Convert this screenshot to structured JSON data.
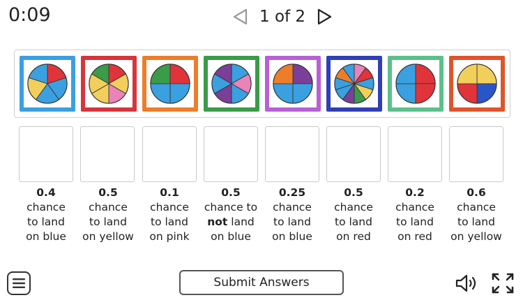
{
  "timer": "0:09",
  "pagination": {
    "label": "1 of 2",
    "prev_icon": "triangle-left-icon",
    "next_icon": "triangle-right-icon"
  },
  "cards": [
    {
      "name": "spinner-card-1",
      "frame_color": "#3aa0e0",
      "slices": [
        "#e0343a",
        "#3aa0e0",
        "#3aa0e0",
        "#f2cf5b",
        "#3aa0e0"
      ]
    },
    {
      "name": "spinner-card-2",
      "frame_color": "#d8343c",
      "slices": [
        "#e0343a",
        "#f2cf5b",
        "#e983b8",
        "#f2cf5b",
        "#f2cf5b",
        "#3a9c48"
      ]
    },
    {
      "name": "spinner-card-3",
      "frame_color": "#ee7d2a",
      "slices": [
        "#e0343a",
        "#3aa0e0",
        "#3aa0e0",
        "#3a9c48"
      ]
    },
    {
      "name": "spinner-card-4",
      "frame_color": "#3a9c48",
      "slices": [
        "#3aa0e0",
        "#e983b8",
        "#3aa0e0",
        "#7a3f98",
        "#3aa0e0",
        "#7a3f98"
      ]
    },
    {
      "name": "spinner-card-5",
      "frame_color": "#b85fd6",
      "slices": [
        "#7a3f98",
        "#3aa0e0",
        "#3aa0e0",
        "#ee7d2a"
      ]
    },
    {
      "name": "spinner-card-6",
      "frame_color": "#2f3fb8",
      "slices": [
        "#e983b8",
        "#e0343a",
        "#3aa0e0",
        "#f2cf5b",
        "#3a9c48",
        "#7a3f98",
        "#3aa0e0",
        "#3aa0e0",
        "#ee7d2a",
        "#3aa0e0"
      ]
    },
    {
      "name": "spinner-card-7",
      "frame_color": "#5bc08a",
      "slices": [
        "#e0343a",
        "#e0343a",
        "#3aa0e0",
        "#3aa0e0"
      ]
    },
    {
      "name": "spinner-card-8",
      "frame_color": "#e0542b",
      "slices": [
        "#f2cf5b",
        "#2a55c6",
        "#e0343a",
        "#f2cf5b"
      ]
    }
  ],
  "descriptions": [
    {
      "value": "0.4",
      "line1": "chance",
      "line2": "to land",
      "line3": "on blue"
    },
    {
      "value": "0.5",
      "line1": "chance",
      "line2": "to land",
      "line3": "on yellow"
    },
    {
      "value": "0.1",
      "line1": "chance",
      "line2": "to land",
      "line3": "on pink"
    },
    {
      "value": "0.5",
      "line1": "chance to",
      "line2_bold": "not",
      "line2_rest": " land",
      "line3": "on blue"
    },
    {
      "value": "0.25",
      "line1": "chance",
      "line2": "to land",
      "line3": "on blue"
    },
    {
      "value": "0.5",
      "line1": "chance",
      "line2": "to land",
      "line3": "on red"
    },
    {
      "value": "0.2",
      "line1": "chance",
      "line2": "to land",
      "line3": "on red"
    },
    {
      "value": "0.6",
      "line1": "chance",
      "line2": "to land",
      "line3": "on yellow"
    }
  ],
  "footer": {
    "menu_icon": "hamburger-menu-icon",
    "submit_label": "Submit Answers",
    "sound_icon": "speaker-icon",
    "fullscreen_icon": "fullscreen-icon"
  }
}
